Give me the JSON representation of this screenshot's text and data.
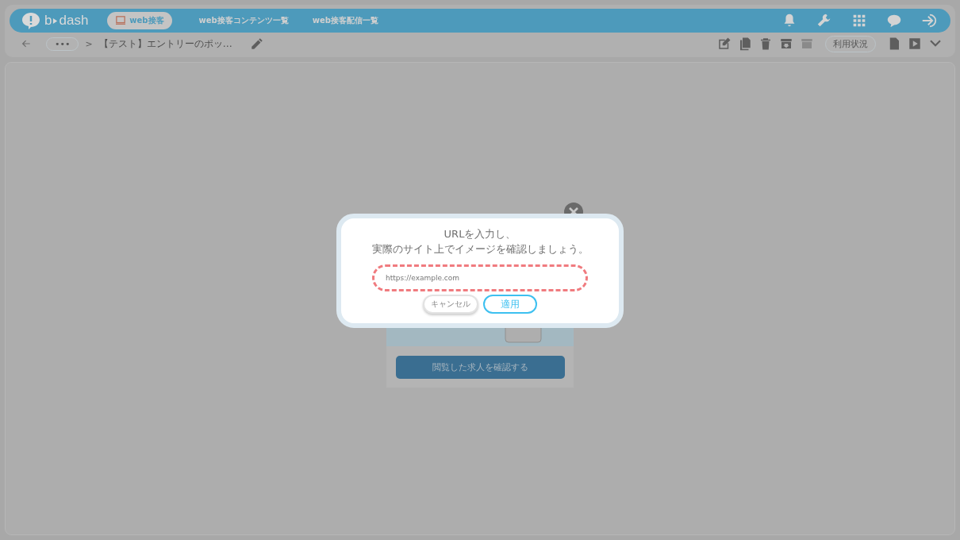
{
  "header": {
    "logo": {
      "left": "b",
      "right": "dash"
    },
    "nav": [
      {
        "label": "web接客",
        "selected": true
      },
      {
        "label": "web接客コンテンツ一覧",
        "selected": false
      },
      {
        "label": "web接客配信一覧",
        "selected": false
      }
    ],
    "icons": [
      {
        "kind": "bell"
      },
      {
        "kind": "wrench"
      },
      {
        "kind": "grid"
      },
      {
        "kind": "chat"
      },
      {
        "kind": "logout"
      }
    ]
  },
  "toolbar": {
    "more": "•••",
    "separator": ">",
    "breadcrumb": "【テスト】エントリーのポッ…",
    "actions": [
      {
        "kind": "edit",
        "disabled": false
      },
      {
        "kind": "copy",
        "disabled": false
      },
      {
        "kind": "trash",
        "disabled": false
      },
      {
        "kind": "download",
        "disabled": false
      },
      {
        "kind": "upload",
        "disabled": true
      }
    ],
    "usage": "利用状況",
    "actions_after": [
      {
        "kind": "document",
        "disabled": false
      },
      {
        "kind": "play",
        "disabled": false
      },
      {
        "kind": "chevron",
        "disabled": false
      }
    ]
  },
  "preview": {
    "cta": "閲覧した求人を確認する"
  },
  "modal": {
    "lines": [
      "URLを入力し、",
      "実際のサイト上でイメージを確認しましょう。"
    ],
    "url": {
      "placeholder": "https://example.com"
    },
    "buttons": [
      {
        "label": "キャンセル",
        "kind": "secondary"
      },
      {
        "label": "適用",
        "kind": "primary"
      }
    ]
  }
}
